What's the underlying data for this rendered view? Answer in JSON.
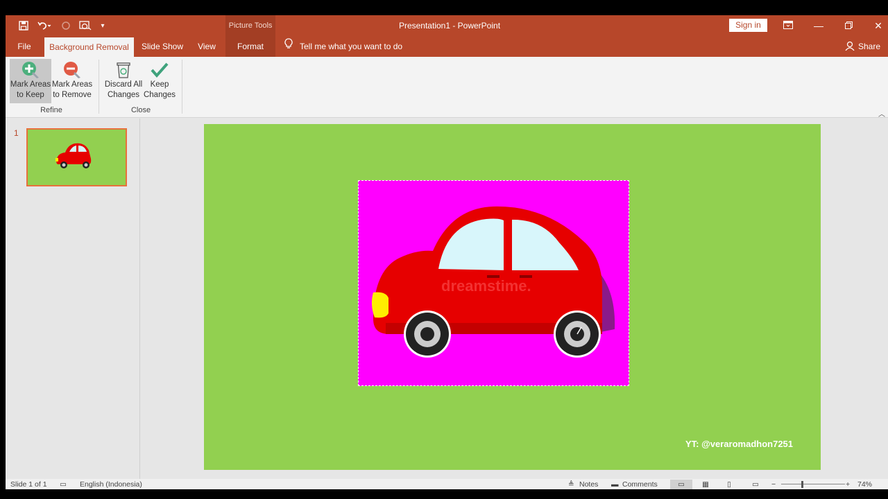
{
  "window": {
    "title": "Presentation1  -  PowerPoint",
    "contextual_group": "Picture Tools",
    "sign_in": "Sign in",
    "controls": [
      "ribbon-display-options",
      "minimize",
      "restore",
      "close"
    ]
  },
  "quick_access": {
    "icons": [
      "save-icon",
      "undo-icon",
      "redo-icon",
      "start-from-beginning-icon",
      "customize-icon"
    ]
  },
  "tabs": {
    "file": "File",
    "background_removal": "Background Removal",
    "slide_show": "Slide Show",
    "view": "View",
    "format": "Format",
    "tell_me": "Tell me what you want to do",
    "share": "Share",
    "active": "Background Removal"
  },
  "ribbon": {
    "refine": {
      "label": "Refine",
      "mark_keep_l1": "Mark Areas",
      "mark_keep_l2": "to Keep",
      "mark_remove_l1": "Mark Areas",
      "mark_remove_l2": "to Remove"
    },
    "close": {
      "label": "Close",
      "discard_l1": "Discard All",
      "discard_l2": "Changes",
      "keep_l1": "Keep",
      "keep_l2": "Changes"
    }
  },
  "thumbnails": [
    {
      "number": "1"
    }
  ],
  "slide": {
    "background": "#92d050",
    "picture_background": "#ff00ff",
    "watermark": "dreamstime.",
    "credit": "YT:  @veraromadhon7251"
  },
  "status_bar": {
    "slide_info": "Slide 1 of 1",
    "language": "English (Indonesia)",
    "notes": "Notes",
    "comments": "Comments",
    "zoom": "74%"
  },
  "colors": {
    "accent": "#b7472a",
    "format_tab": "#a33e24",
    "thumb_border": "#e8703c",
    "car_body": "#e60000",
    "headlight": "#ffee00"
  }
}
